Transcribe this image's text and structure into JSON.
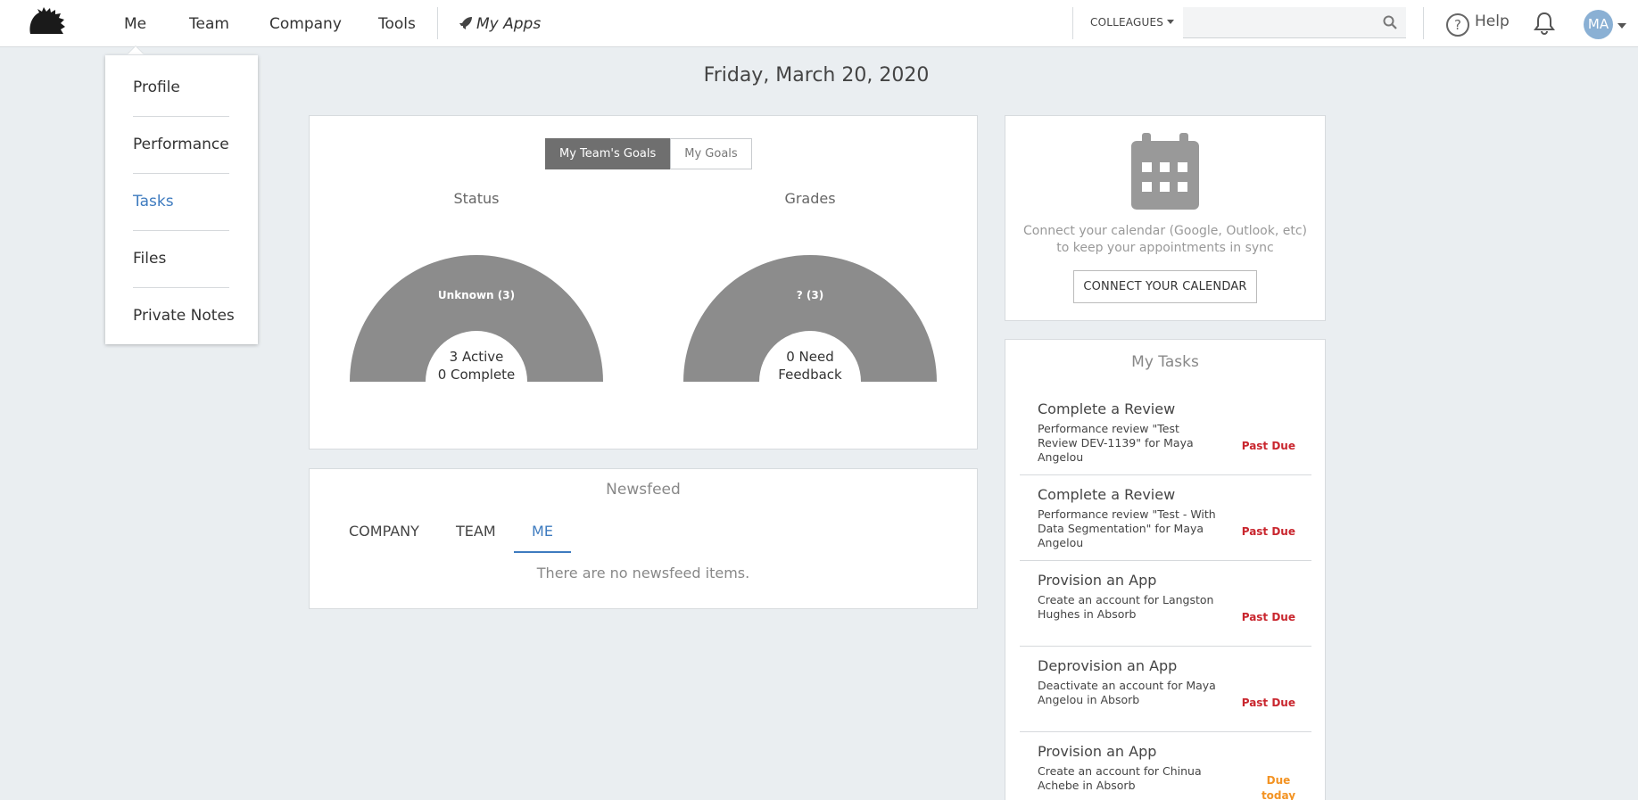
{
  "nav": {
    "items": [
      {
        "label": "Me",
        "active": true
      },
      {
        "label": "Team"
      },
      {
        "label": "Company"
      },
      {
        "label": "Tools"
      }
    ],
    "apps_label": "My Apps",
    "colleagues_label": "COLLEAGUES",
    "search_placeholder": "",
    "help_label": "Help",
    "avatar_initials": "MA"
  },
  "dropdown": {
    "items": [
      {
        "label": "Profile"
      },
      {
        "label": "Performance"
      },
      {
        "label": "Tasks",
        "active": true
      },
      {
        "label": "Files"
      },
      {
        "label": "Private Notes"
      }
    ]
  },
  "date": "Friday, March 20, 2020",
  "goals": {
    "toggle": [
      "My Team's Goals",
      "My Goals"
    ],
    "active_toggle": 0,
    "status": {
      "title": "Status",
      "segment_label": "Unknown (3)",
      "center_line1": "3 Active",
      "center_line2": "0 Complete"
    },
    "grades": {
      "title": "Grades",
      "segment_label": "? (3)",
      "center_line1": "0 Need",
      "center_line2": "Feedback"
    }
  },
  "chart_data": [
    {
      "type": "pie",
      "title": "Status",
      "categories": [
        "Unknown"
      ],
      "values": [
        3
      ],
      "colors": [
        "#8c8c8c"
      ]
    },
    {
      "type": "pie",
      "title": "Grades",
      "categories": [
        "?"
      ],
      "values": [
        3
      ],
      "colors": [
        "#8c8c8c"
      ]
    }
  ],
  "newsfeed": {
    "title": "Newsfeed",
    "tabs": [
      "COMPANY",
      "TEAM",
      "ME"
    ],
    "active_tab": 2,
    "empty_text": "There are no newsfeed items."
  },
  "calendar": {
    "text_line1": "Connect your calendar (Google, Outlook, etc)",
    "text_line2": "to keep your appointments in sync",
    "button_label": "CONNECT YOUR CALENDAR"
  },
  "tasks": {
    "title": "My Tasks",
    "items": [
      {
        "title": "Complete a Review",
        "description": "Performance review \"Test Review DEV-1139\" for Maya Angelou",
        "status": "Past Due"
      },
      {
        "title": "Complete a Review",
        "description": "Performance review \"Test - With Data Segmentation\" for Maya Angelou",
        "status": "Past Due"
      },
      {
        "title": "Provision an App",
        "description": "Create an account for Langston Hughes in Absorb",
        "status": "Past Due"
      },
      {
        "title": "Deprovision an App",
        "description": "Deactivate an account for Maya Angelou in Absorb",
        "status": "Past Due"
      },
      {
        "title": "Provision an App",
        "description": "Create an account for Chinua Achebe in Absorb",
        "status": "Due today"
      }
    ]
  },
  "colors": {
    "accent": "#3e7bbf",
    "past_due": "#c9262e",
    "due_today": "#f39323",
    "gauge": "#8c8c8c"
  }
}
